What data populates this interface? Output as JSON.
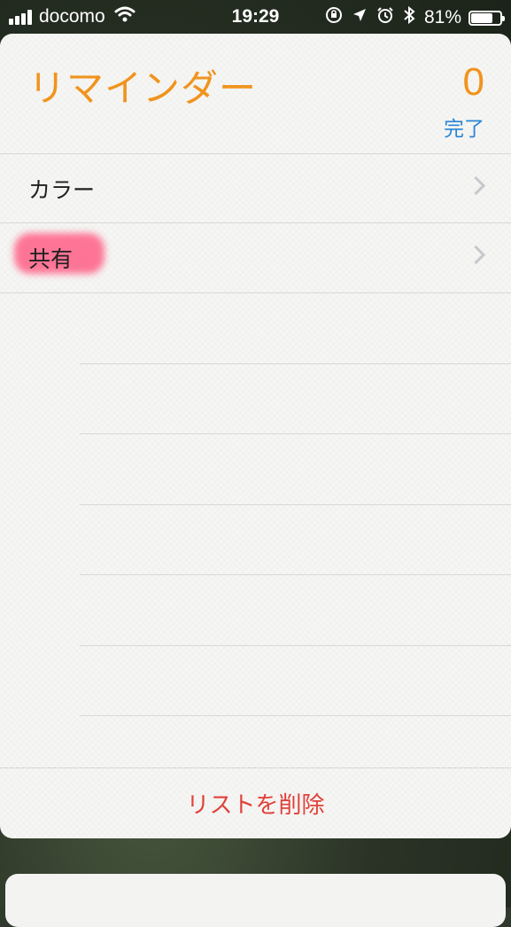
{
  "status_bar": {
    "carrier": "docomo",
    "time": "19:29",
    "battery": "81%",
    "battery_level": 0.81,
    "icons": [
      "signal-icon",
      "wifi-icon",
      "orientation-lock-icon",
      "location-icon",
      "alarm-icon",
      "bluetooth-icon",
      "battery-icon"
    ]
  },
  "card": {
    "title": "リマインダー",
    "count": "0",
    "done_label": "完了",
    "rows": [
      {
        "label": "カラー"
      },
      {
        "label": "共有"
      }
    ],
    "delete_label": "リストを削除"
  },
  "colors": {
    "title": "#f0941e",
    "done": "#2a86d6",
    "delete": "#e0413a",
    "highlight": "#ff5f86"
  }
}
